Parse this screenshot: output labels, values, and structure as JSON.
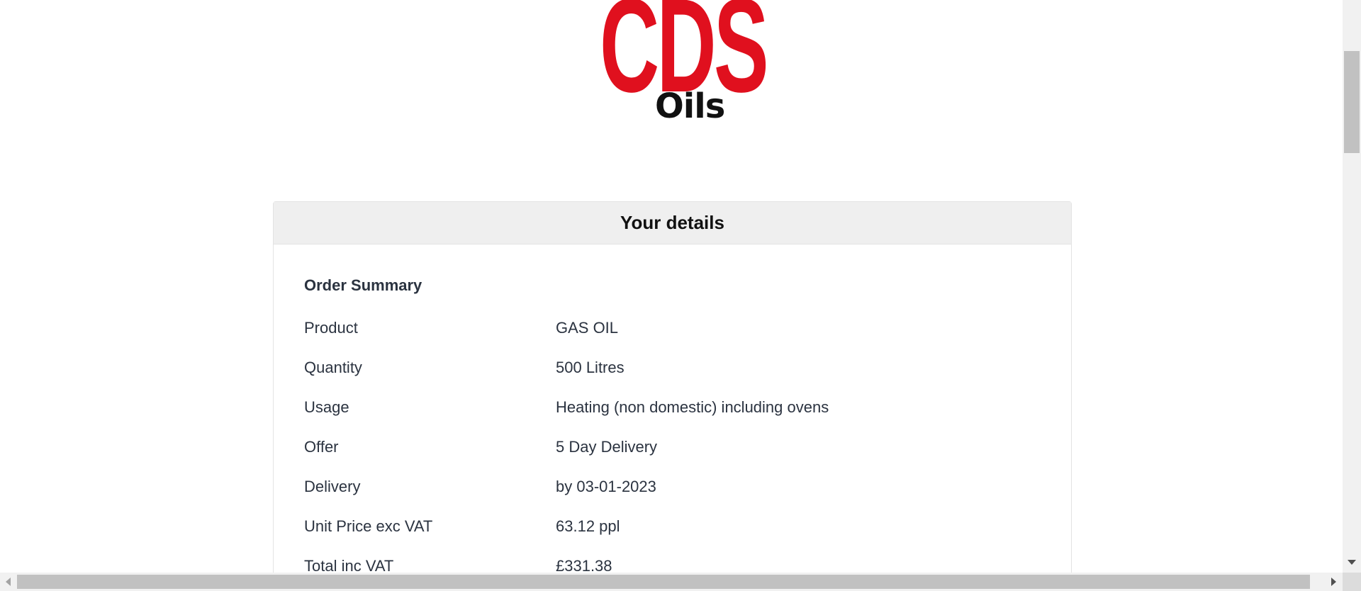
{
  "logo": {
    "letters": "CDS",
    "word": "Oils"
  },
  "card": {
    "title": "Your details",
    "summary_title": "Order Summary",
    "rows": [
      {
        "label": "Product",
        "value": "GAS OIL"
      },
      {
        "label": "Quantity",
        "value": "500 Litres"
      },
      {
        "label": "Usage",
        "value": "Heating (non domestic) including ovens"
      },
      {
        "label": "Offer",
        "value": "5 Day Delivery"
      },
      {
        "label": "Delivery",
        "value": "by 03-01-2023"
      },
      {
        "label": "Unit Price exc VAT",
        "value": "63.12 ppl"
      },
      {
        "label": "Total inc VAT",
        "value": "£331.38"
      }
    ]
  },
  "colors": {
    "brand_red": "#e0101e",
    "header_bg": "#efefef",
    "text": "#2b3340"
  }
}
